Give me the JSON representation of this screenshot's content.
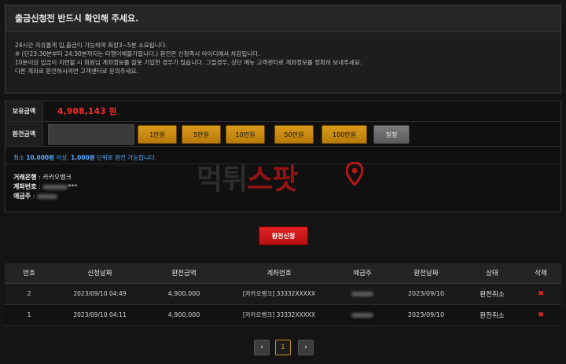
{
  "notice": {
    "title": "출금신청전 반드시 확인해 주세요.",
    "lines": [
      "24시간 자유롭게 입,출금이 가능하며 최장3~5분 소요됩니다.",
      "※ (단23:30분부터 24:30분까지는 타행이체불가합니다.) 환전은 신청즉시 아이디에서 차감됩니다.",
      "10분이상 입금이 지연될 시 회원님 계좌정보를 잘못 기입한 경우가 많습니다. 그럴경우, 상단 메뉴 고객센터로 계좌정보를 정확히 보내주세요.",
      "다른 계좌로 환전하시려면 고객센터로 문의주세요."
    ]
  },
  "form": {
    "balance_label": "보유금액",
    "balance_value": "4,908,143 원",
    "amount_label": "환전금액",
    "amount_value": "",
    "buttons": [
      "1만원",
      "5만원",
      "10만원",
      "50만원",
      "100만원"
    ],
    "reset_label": "정정",
    "min_note_a": "최소 ",
    "min_note_b": "10,000원",
    "min_note_c": " 이상, ",
    "min_note_d": "1,000원",
    "min_note_e": " 단위로 환전 가능합니다.",
    "bank_key": "거래은행",
    "bank_value": "카카오뱅크",
    "account_key": "계좌번호",
    "account_value": "***",
    "holder_key": "예금주",
    "submit_label": "환전신청"
  },
  "watermark": {
    "left": "먹튀",
    "right": "스팟"
  },
  "table": {
    "headers": [
      "번호",
      "신청날짜",
      "환전금액",
      "계좌번호",
      "예금주",
      "환전날짜",
      "상태",
      "삭제"
    ],
    "rows": [
      {
        "no": "2",
        "req_date": "2023/09/10 04:49",
        "amount": "4,900,000",
        "account": "[카카오뱅크] 33332XXXXX",
        "ex_date": "2023/09/10",
        "status": "환전취소",
        "del": "✖"
      },
      {
        "no": "1",
        "req_date": "2023/09/10 04:11",
        "amount": "4,900,000",
        "account": "[카카오뱅크] 33332XXXXX",
        "ex_date": "2023/09/10",
        "status": "환전취소",
        "del": "✖"
      }
    ]
  },
  "pagination": {
    "prev": "‹",
    "current": "1",
    "next": "›"
  },
  "colors": {
    "accent_gold": "#d99a1b",
    "balance_red": "#ff2a2a",
    "submit_red": "#d61a1a",
    "note_blue": "#58a9ff"
  }
}
